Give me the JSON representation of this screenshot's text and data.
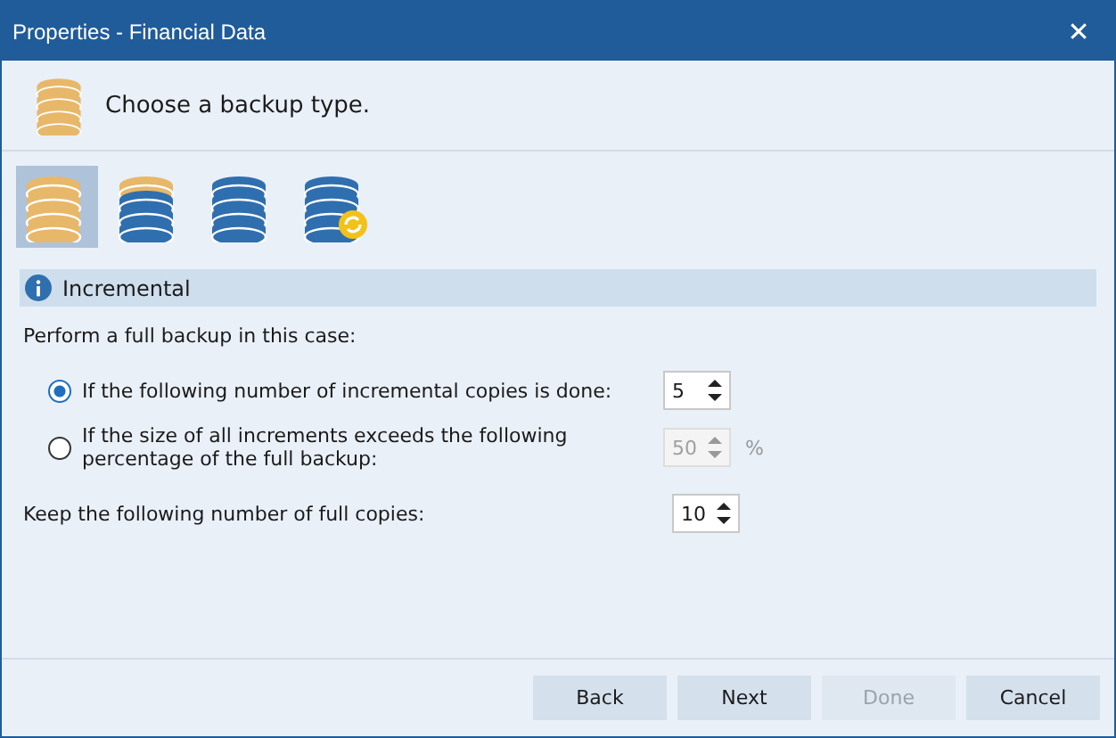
{
  "window": {
    "title": "Properties - Financial Data",
    "close": "✕"
  },
  "header": {
    "text": "Choose a backup type."
  },
  "backup_types": [
    {
      "kind": "full",
      "selected": true
    },
    {
      "kind": "mixed",
      "selected": false
    },
    {
      "kind": "plain",
      "selected": false
    },
    {
      "kind": "sync",
      "selected": false
    }
  ],
  "section": {
    "title": "Incremental"
  },
  "intro": "Perform a full backup in this case:",
  "options": [
    {
      "label": "If the following number of incremental copies is done:",
      "selected": true,
      "value": "5",
      "disabled": false
    },
    {
      "label": "If the size of all increments exceeds the following percentage of the full backup:",
      "selected": false,
      "value": "50",
      "disabled": true,
      "unit": "%"
    }
  ],
  "keep": {
    "label": "Keep the following number of full copies:",
    "value": "10"
  },
  "buttons": [
    {
      "label": "Back",
      "disabled": false
    },
    {
      "label": "Next",
      "disabled": false
    },
    {
      "label": "Done",
      "disabled": true
    },
    {
      "label": "Cancel",
      "disabled": false
    }
  ]
}
